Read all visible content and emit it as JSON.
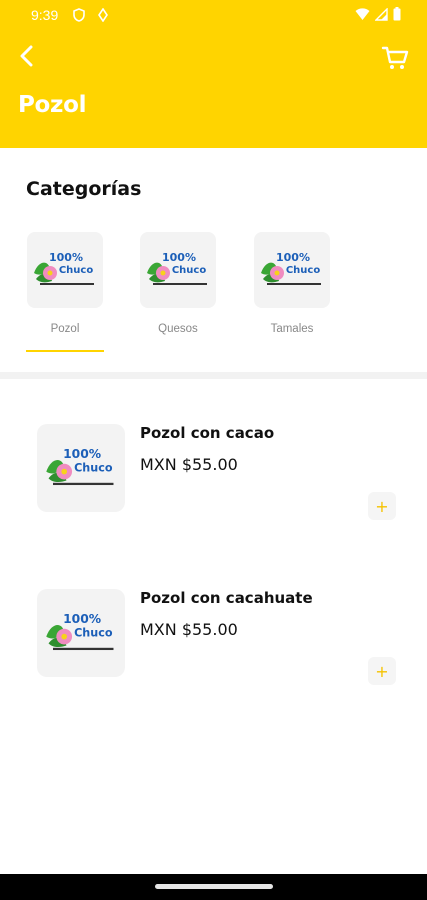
{
  "status_bar": {
    "time": "9:39"
  },
  "header": {
    "title": "Pozol"
  },
  "categories": {
    "title": "Categorías",
    "items": [
      {
        "label": "Pozol"
      },
      {
        "label": "Quesos"
      },
      {
        "label": "Tamales"
      }
    ],
    "selected": "Pozol"
  },
  "products": [
    {
      "name": "Pozol con cacao",
      "price": "MXN $55.00",
      "add_label": "+"
    },
    {
      "name": "Pozol con cacahuate",
      "price": "MXN $55.00",
      "add_label": "+"
    }
  ],
  "colors": {
    "accent": "#FFD400",
    "add_icon": "#F5C200"
  },
  "icons": [
    "back-arrow-icon",
    "cart-icon",
    "logo-image",
    "plus-icon",
    "wifi-icon",
    "signal-icon",
    "battery-icon"
  ]
}
